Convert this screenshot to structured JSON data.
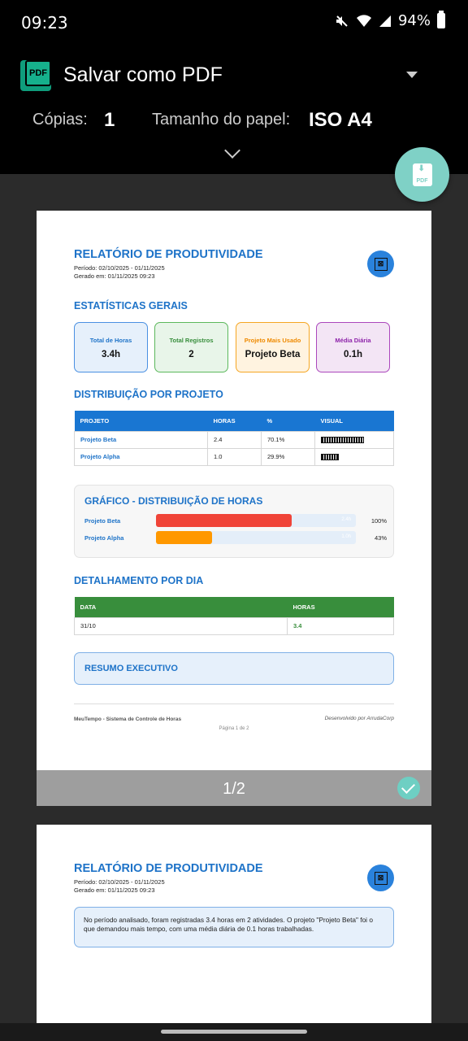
{
  "status_bar": {
    "time": "09:23",
    "battery": "94%",
    "icons": [
      "mute-icon",
      "wifi-icon",
      "signal-icon",
      "battery-icon"
    ]
  },
  "print_header": {
    "title": "Salvar como PDF",
    "copies_label": "Cópias:",
    "copies_value": "1",
    "paper_label": "Tamanho do papel:",
    "paper_value": "ISO A4",
    "logo_text": "PDF",
    "fab_text": "PDF"
  },
  "report": {
    "title": "RELATÓRIO DE PRODUTIVIDADE",
    "period": "Período: 02/10/2025 - 01/11/2025",
    "generated": "Gerado em: 01/11/2025 09:23",
    "stats_title": "ESTATÍSTICAS GERAIS",
    "stats": [
      {
        "label": "Total de Horas",
        "value": "3.4h"
      },
      {
        "label": "Total Registros",
        "value": "2"
      },
      {
        "label": "Projeto Mais Usado",
        "value": "Projeto Beta"
      },
      {
        "label": "Média Diária",
        "value": "0.1h"
      }
    ],
    "dist_title": "DISTRIBUIÇÃO POR PROJETO",
    "dist_headers": [
      "PROJETO",
      "HORAS",
      "%",
      "VISUAL"
    ],
    "dist_rows": [
      {
        "project": "Projeto Beta",
        "hours": "2.4",
        "pct": "70.1%",
        "visual": 0.701
      },
      {
        "project": "Projeto Alpha",
        "hours": "1.0",
        "pct": "29.9%",
        "visual": 0.299
      }
    ],
    "chart_title": "GRÁFICO - DISTRIBUIÇÃO DE HORAS",
    "chart_bars": [
      {
        "name": "Projeto Beta",
        "fill": 0.68,
        "color": "#f04438",
        "inner": "2.4h",
        "pct": "100%"
      },
      {
        "name": "Projeto Alpha",
        "fill": 0.28,
        "color": "#ff9800",
        "inner": "1.0h",
        "pct": "43%"
      }
    ],
    "daily_title": "DETALHAMENTO POR DIA",
    "daily_headers": [
      "DATA",
      "HORAS"
    ],
    "daily_rows": [
      {
        "date": "31/10",
        "hours": "3.4"
      }
    ],
    "summary_title": "RESUMO EXECUTIVO",
    "summary_text": "No período analisado, foram registradas 3.4 horas em 2 atividades. O projeto \"Projeto Beta\" foi o que demandou mais tempo, com uma média diária de 0.1 horas trabalhadas.",
    "footer_left": "MeuTempo - Sistema de Controle de Horas",
    "footer_right": "Desenvolvido por ArrudaCorp",
    "footer_page": "Página 1 de 2"
  },
  "pager": {
    "page1": "1/2"
  },
  "colors": {
    "accent": "#1e73c8",
    "table_blue": "#1976d2",
    "table_green": "#388e3c",
    "teal": "#7fd1c6"
  }
}
